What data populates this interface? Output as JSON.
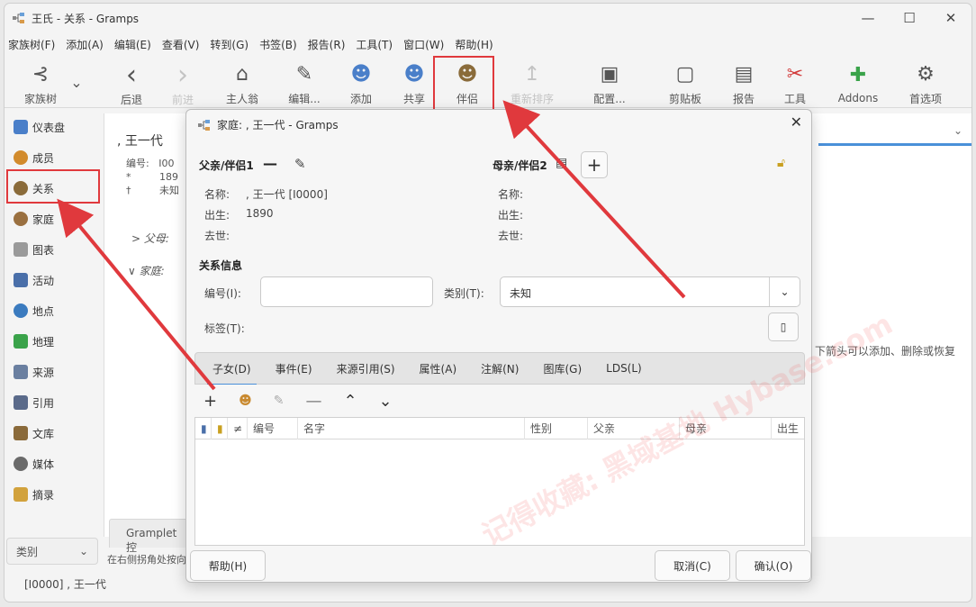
{
  "window": {
    "title": "王氏 - 关系 - Gramps",
    "min": "—",
    "max": "☐",
    "close": "✕"
  },
  "menu": [
    "家族树(F)",
    "添加(A)",
    "编辑(E)",
    "查看(V)",
    "转到(G)",
    "书签(B)",
    "报告(R)",
    "工具(T)",
    "窗口(W)",
    "帮助(H)"
  ],
  "toolbar": [
    {
      "label": "家族树",
      "icon": "family-tree-icon",
      "glyph": "⊰"
    },
    {
      "label": "",
      "icon": "chevron-down-icon",
      "glyph": "⌄"
    },
    {
      "label": "后退",
      "icon": "back-icon",
      "glyph": "‹"
    },
    {
      "label": "前进",
      "icon": "forward-icon",
      "glyph": "›"
    },
    {
      "label": "主人翁",
      "icon": "home-icon",
      "glyph": "⌂"
    },
    {
      "label": "编辑...",
      "icon": "edit-icon",
      "glyph": "✎"
    },
    {
      "label": "添加",
      "icon": "add-person-icon",
      "glyph": "☻"
    },
    {
      "label": "共享",
      "icon": "share-icon",
      "glyph": "☻"
    },
    {
      "label": "伴侣",
      "icon": "partner-icon",
      "glyph": "☻"
    },
    {
      "label": "重新排序",
      "icon": "reorder-icon",
      "glyph": "↥"
    },
    {
      "label": "配置...",
      "icon": "configure-icon",
      "glyph": "▣"
    },
    {
      "label": "剪贴板",
      "icon": "clipboard-icon",
      "glyph": "▢"
    },
    {
      "label": "报告",
      "icon": "report-icon",
      "glyph": "▤"
    },
    {
      "label": "工具",
      "icon": "tools-icon",
      "glyph": "✂"
    },
    {
      "label": "Addons",
      "icon": "addons-icon",
      "glyph": "✚"
    },
    {
      "label": "首选项",
      "icon": "preferences-icon",
      "glyph": "⚙"
    }
  ],
  "sidebar": [
    {
      "label": "仪表盘",
      "icon": "dashboard-icon",
      "color": "#4a7fc9"
    },
    {
      "label": "成员",
      "icon": "person-icon",
      "color": "#d28b2c"
    },
    {
      "label": "关系",
      "icon": "relationships-icon",
      "color": "#8a6b3a"
    },
    {
      "label": "家庭",
      "icon": "family-icon",
      "color": "#9a7040"
    },
    {
      "label": "图表",
      "icon": "charts-icon",
      "color": "#7a7a7a"
    },
    {
      "label": "活动",
      "icon": "events-icon",
      "color": "#4a6fa9"
    },
    {
      "label": "地点",
      "icon": "places-icon",
      "color": "#3b7bbf"
    },
    {
      "label": "地理",
      "icon": "geography-icon",
      "color": "#3aa34a"
    },
    {
      "label": "来源",
      "icon": "sources-icon",
      "color": "#6a7fa0"
    },
    {
      "label": "引用",
      "icon": "citations-icon",
      "color": "#5a6a8a"
    },
    {
      "label": "文库",
      "icon": "repositories-icon",
      "color": "#8a6a3a"
    },
    {
      "label": "媒体",
      "icon": "media-icon",
      "color": "#6a6a6a"
    },
    {
      "label": "摘录",
      "icon": "notes-icon",
      "color": "#d2a23c"
    }
  ],
  "category": "类别",
  "status": "[I0000] , 王一代",
  "relview": {
    "name": ", 王一代",
    "rows": [
      "编号:",
      "*",
      "†"
    ],
    "vals": [
      "I00",
      "189",
      "未知"
    ],
    "parents": "> 父母:",
    "family": "∨ 家庭:",
    "gramplet": "Gramplet 控",
    "hint_left": "在右侧拐角处按向",
    "hint_right": "下箭头可以添加、删除或恢复"
  },
  "dialog": {
    "title": "家庭: , 王一代 - Gramps",
    "father_label": "父亲/伴侣1",
    "mother_label": "母亲/伴侣2",
    "name_label": "名称:",
    "father_name": ", 王一代 [I0000]",
    "birth_label": "出生:",
    "father_birth": "1890",
    "death_label": "去世:",
    "relinfo": "关系信息",
    "id_label": "编号(I):",
    "id_value": "",
    "type_label": "类别(T):",
    "type_value": "未知",
    "tags_label": "标签(T):",
    "tabs": [
      "子女(D)",
      "事件(E)",
      "来源引用(S)",
      "属性(A)",
      "注解(N)",
      "图库(G)",
      "LDS(L)"
    ],
    "columns": [
      "≠",
      "编号",
      "名字",
      "性别",
      "父亲",
      "母亲",
      "出生"
    ],
    "help": "帮助(H)",
    "cancel": "取消(C)",
    "ok": "确认(O)"
  },
  "watermark": "记得收藏: 黑域基地 Hybase.com"
}
